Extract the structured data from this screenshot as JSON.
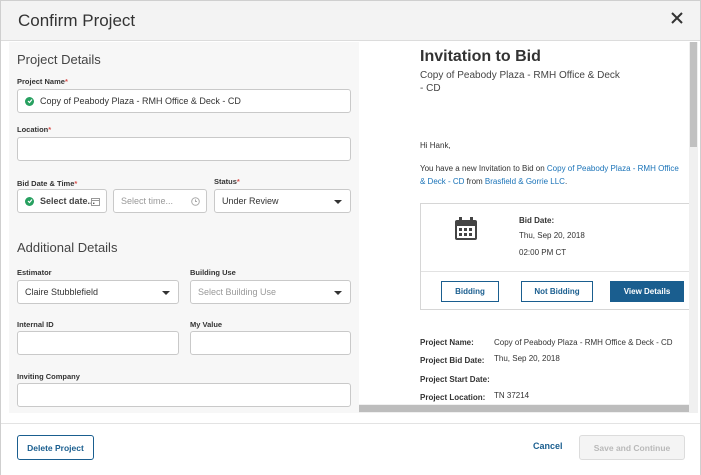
{
  "modal": {
    "title": "Confirm Project"
  },
  "form": {
    "project_details_title": "Project Details",
    "project_name_label": "Project Name",
    "project_name_value": "Copy of Peabody Plaza - RMH Office & Deck - CD",
    "location_label": "Location",
    "location_value": "",
    "bid_date_label": "Bid Date & Time",
    "bid_date_placeholder": "Select date...",
    "bid_time_placeholder": "Select time...",
    "status_label": "Status",
    "status_value": "Under Review",
    "additional_details_title": "Additional Details",
    "estimator_label": "Estimator",
    "estimator_value": "Claire Stubblefield",
    "building_use_label": "Building Use",
    "building_use_placeholder": "Select Building Use",
    "internal_id_label": "Internal ID",
    "my_value_label": "My Value",
    "inviting_company_label": "Inviting Company",
    "required_mark": "*"
  },
  "preview": {
    "title": "Invitation to Bid",
    "subtitle": "Copy of Peabody Plaza - RMH Office & Deck - CD",
    "greeting": "Hi Hank,",
    "message_prefix": "You have a new Invitation to Bid on ",
    "message_project_link": "Copy of Peabody Plaza - RMH Office & Deck - CD",
    "message_from": " from ",
    "message_company_link": "Brasfield & Gorrie LLC",
    "message_suffix": ".",
    "bid_date_label": "Bid Date:",
    "bid_date_value": "Thu, Sep 20, 2018",
    "bid_time_value": "02:00 PM CT",
    "bidding_button": "Bidding",
    "not_bidding_button": "Not Bidding",
    "view_details_button": "View Details",
    "project_name_label": "Project Name:",
    "project_name_value": "Copy of Peabody Plaza - RMH Office & Deck - CD",
    "project_bid_date_label": "Project Bid Date:",
    "project_bid_date_value": "Thu, Sep 20, 2018",
    "project_start_date_label": "Project Start Date:",
    "project_location_label": "Project Location:",
    "project_location_value": "TN 37214"
  },
  "footer": {
    "delete_button": "Delete Project",
    "cancel_button": "Cancel",
    "save_button": "Save and Continue"
  },
  "colors": {
    "accent": "#1a5e8f",
    "link": "#1a73b8",
    "required": "#d9534f",
    "success": "#27a060"
  },
  "icons": [
    "close-icon",
    "check-circle-icon",
    "calendar-icon",
    "clock-icon",
    "chevron-down-icon"
  ]
}
